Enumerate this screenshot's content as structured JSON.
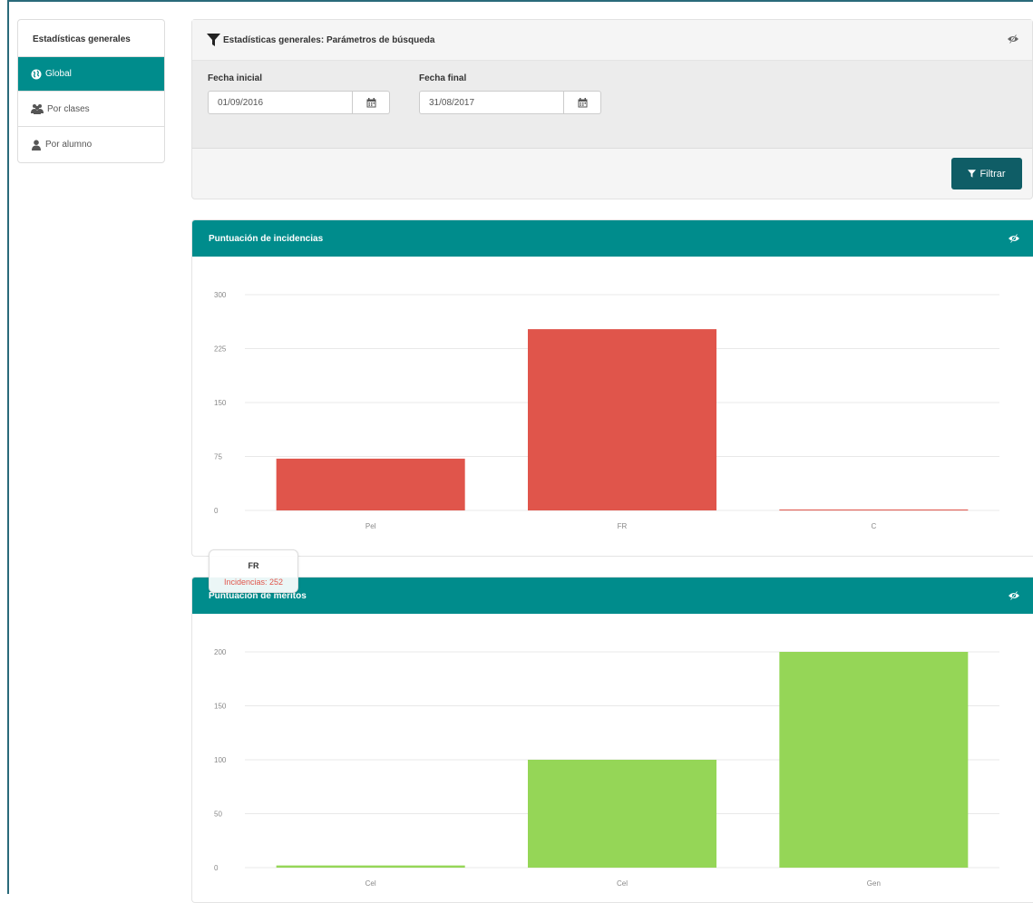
{
  "sidebar": {
    "title": "Estadísticas generales",
    "items": [
      {
        "label": "Global",
        "icon": "globe-icon",
        "active": true
      },
      {
        "label": "Por clases",
        "icon": "users-icon",
        "active": false
      },
      {
        "label": "Por alumno",
        "icon": "user-icon",
        "active": false
      }
    ]
  },
  "filter": {
    "title": "Estadísticas generales: Parámetros de búsqueda",
    "start_label": "Fecha inicial",
    "start_value": "01/09/2016",
    "end_label": "Fecha final",
    "end_value": "31/08/2017",
    "button_label": "Filtrar"
  },
  "colors": {
    "accent": "#008c8c",
    "button": "#0f5d66",
    "incidencias_bar": "#e0554b",
    "meritos_bar": "#95d657"
  },
  "chart_data": [
    {
      "type": "bar",
      "title": "Puntuación de incidencias",
      "categories": [
        "Pel",
        "FR",
        "C"
      ],
      "values": [
        72,
        252,
        1
      ],
      "yticks": [
        0,
        75,
        150,
        225,
        300
      ],
      "ylim": [
        0,
        300
      ],
      "color": "#e0554b",
      "grid": true
    },
    {
      "type": "bar",
      "title": "Puntuación de méritos",
      "categories": [
        "Cel",
        "Cel",
        "Gen"
      ],
      "values": [
        2,
        100,
        200
      ],
      "yticks": [
        0,
        50,
        100,
        150,
        200
      ],
      "ylim": [
        0,
        200
      ],
      "color": "#95d657",
      "grid": true
    }
  ],
  "tooltip": {
    "title": "FR",
    "line": "Incidencias: 252"
  }
}
